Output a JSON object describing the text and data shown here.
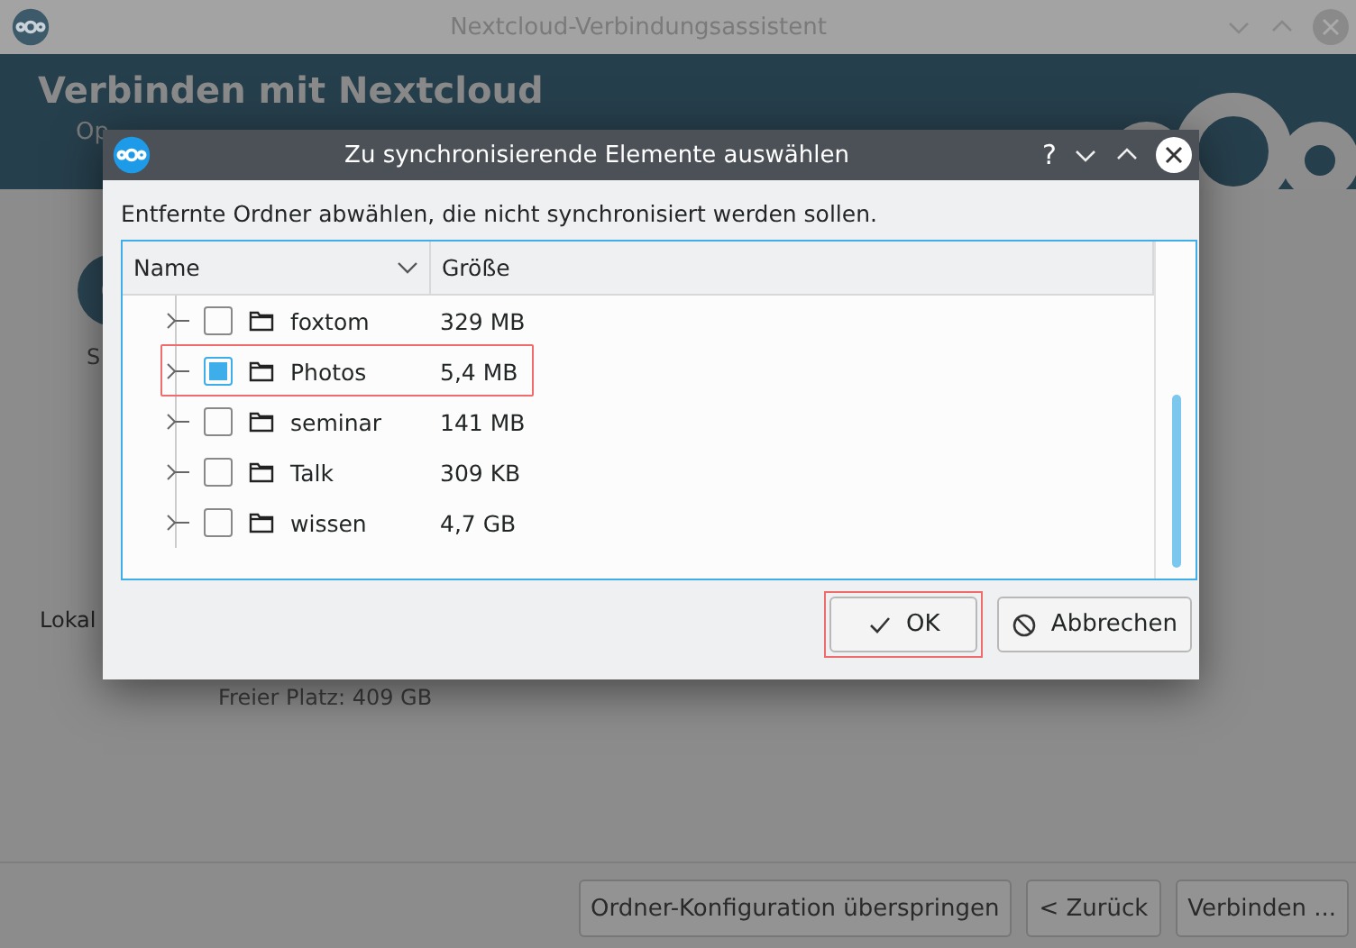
{
  "main_window": {
    "title": "Nextcloud-Verbindungsassistent",
    "header_title": "Verbinden mit Nextcloud",
    "header_subtitle": "Op",
    "body_texts": [
      "S",
      "Lokal",
      "Freier Platz: 409 GB"
    ],
    "buttons": [
      {
        "label": "Ordner-Konfiguration überspringen"
      },
      {
        "label": "< Zurück"
      },
      {
        "label": "Verbinden ..."
      }
    ]
  },
  "dialog": {
    "title": "Zu synchronisierende Elemente auswählen",
    "title_buttons": [
      "?"
    ],
    "instruction": "Entfernte Ordner abwählen, die nicht synchronisiert werden sollen.",
    "columns": [
      "Name",
      "Größe"
    ],
    "rows": [
      {
        "name": "foxtom",
        "size": "329 MB",
        "checked": false,
        "highlighted": false
      },
      {
        "name": "Photos",
        "size": "5,4 MB",
        "checked": true,
        "highlighted": true
      },
      {
        "name": "seminar",
        "size": "141 MB",
        "checked": false,
        "highlighted": false
      },
      {
        "name": "Talk",
        "size": "309 KB",
        "checked": false,
        "highlighted": false
      },
      {
        "name": "wissen",
        "size": "4,7 GB",
        "checked": false,
        "highlighted": false
      }
    ],
    "buttons": [
      {
        "label": "OK",
        "kind": "ok",
        "highlighted": true
      },
      {
        "label": "Abbrechen",
        "kind": "cancel",
        "highlighted": false
      }
    ]
  }
}
